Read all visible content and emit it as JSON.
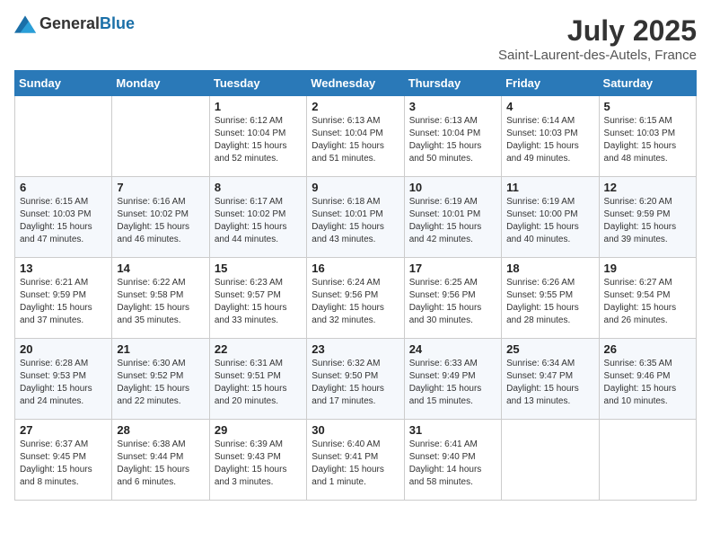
{
  "header": {
    "logo_general": "General",
    "logo_blue": "Blue",
    "month_year": "July 2025",
    "location": "Saint-Laurent-des-Autels, France"
  },
  "weekdays": [
    "Sunday",
    "Monday",
    "Tuesday",
    "Wednesday",
    "Thursday",
    "Friday",
    "Saturday"
  ],
  "weeks": [
    [
      {
        "day": "",
        "info": ""
      },
      {
        "day": "",
        "info": ""
      },
      {
        "day": "1",
        "info": "Sunrise: 6:12 AM\nSunset: 10:04 PM\nDaylight: 15 hours\nand 52 minutes."
      },
      {
        "day": "2",
        "info": "Sunrise: 6:13 AM\nSunset: 10:04 PM\nDaylight: 15 hours\nand 51 minutes."
      },
      {
        "day": "3",
        "info": "Sunrise: 6:13 AM\nSunset: 10:04 PM\nDaylight: 15 hours\nand 50 minutes."
      },
      {
        "day": "4",
        "info": "Sunrise: 6:14 AM\nSunset: 10:03 PM\nDaylight: 15 hours\nand 49 minutes."
      },
      {
        "day": "5",
        "info": "Sunrise: 6:15 AM\nSunset: 10:03 PM\nDaylight: 15 hours\nand 48 minutes."
      }
    ],
    [
      {
        "day": "6",
        "info": "Sunrise: 6:15 AM\nSunset: 10:03 PM\nDaylight: 15 hours\nand 47 minutes."
      },
      {
        "day": "7",
        "info": "Sunrise: 6:16 AM\nSunset: 10:02 PM\nDaylight: 15 hours\nand 46 minutes."
      },
      {
        "day": "8",
        "info": "Sunrise: 6:17 AM\nSunset: 10:02 PM\nDaylight: 15 hours\nand 44 minutes."
      },
      {
        "day": "9",
        "info": "Sunrise: 6:18 AM\nSunset: 10:01 PM\nDaylight: 15 hours\nand 43 minutes."
      },
      {
        "day": "10",
        "info": "Sunrise: 6:19 AM\nSunset: 10:01 PM\nDaylight: 15 hours\nand 42 minutes."
      },
      {
        "day": "11",
        "info": "Sunrise: 6:19 AM\nSunset: 10:00 PM\nDaylight: 15 hours\nand 40 minutes."
      },
      {
        "day": "12",
        "info": "Sunrise: 6:20 AM\nSunset: 9:59 PM\nDaylight: 15 hours\nand 39 minutes."
      }
    ],
    [
      {
        "day": "13",
        "info": "Sunrise: 6:21 AM\nSunset: 9:59 PM\nDaylight: 15 hours\nand 37 minutes."
      },
      {
        "day": "14",
        "info": "Sunrise: 6:22 AM\nSunset: 9:58 PM\nDaylight: 15 hours\nand 35 minutes."
      },
      {
        "day": "15",
        "info": "Sunrise: 6:23 AM\nSunset: 9:57 PM\nDaylight: 15 hours\nand 33 minutes."
      },
      {
        "day": "16",
        "info": "Sunrise: 6:24 AM\nSunset: 9:56 PM\nDaylight: 15 hours\nand 32 minutes."
      },
      {
        "day": "17",
        "info": "Sunrise: 6:25 AM\nSunset: 9:56 PM\nDaylight: 15 hours\nand 30 minutes."
      },
      {
        "day": "18",
        "info": "Sunrise: 6:26 AM\nSunset: 9:55 PM\nDaylight: 15 hours\nand 28 minutes."
      },
      {
        "day": "19",
        "info": "Sunrise: 6:27 AM\nSunset: 9:54 PM\nDaylight: 15 hours\nand 26 minutes."
      }
    ],
    [
      {
        "day": "20",
        "info": "Sunrise: 6:28 AM\nSunset: 9:53 PM\nDaylight: 15 hours\nand 24 minutes."
      },
      {
        "day": "21",
        "info": "Sunrise: 6:30 AM\nSunset: 9:52 PM\nDaylight: 15 hours\nand 22 minutes."
      },
      {
        "day": "22",
        "info": "Sunrise: 6:31 AM\nSunset: 9:51 PM\nDaylight: 15 hours\nand 20 minutes."
      },
      {
        "day": "23",
        "info": "Sunrise: 6:32 AM\nSunset: 9:50 PM\nDaylight: 15 hours\nand 17 minutes."
      },
      {
        "day": "24",
        "info": "Sunrise: 6:33 AM\nSunset: 9:49 PM\nDaylight: 15 hours\nand 15 minutes."
      },
      {
        "day": "25",
        "info": "Sunrise: 6:34 AM\nSunset: 9:47 PM\nDaylight: 15 hours\nand 13 minutes."
      },
      {
        "day": "26",
        "info": "Sunrise: 6:35 AM\nSunset: 9:46 PM\nDaylight: 15 hours\nand 10 minutes."
      }
    ],
    [
      {
        "day": "27",
        "info": "Sunrise: 6:37 AM\nSunset: 9:45 PM\nDaylight: 15 hours\nand 8 minutes."
      },
      {
        "day": "28",
        "info": "Sunrise: 6:38 AM\nSunset: 9:44 PM\nDaylight: 15 hours\nand 6 minutes."
      },
      {
        "day": "29",
        "info": "Sunrise: 6:39 AM\nSunset: 9:43 PM\nDaylight: 15 hours\nand 3 minutes."
      },
      {
        "day": "30",
        "info": "Sunrise: 6:40 AM\nSunset: 9:41 PM\nDaylight: 15 hours\nand 1 minute."
      },
      {
        "day": "31",
        "info": "Sunrise: 6:41 AM\nSunset: 9:40 PM\nDaylight: 14 hours\nand 58 minutes."
      },
      {
        "day": "",
        "info": ""
      },
      {
        "day": "",
        "info": ""
      }
    ]
  ]
}
